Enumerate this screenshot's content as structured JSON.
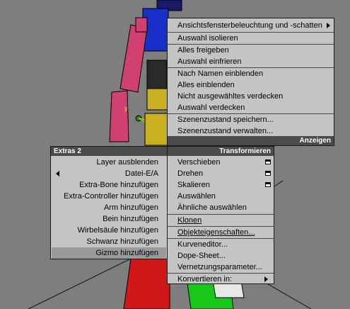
{
  "colors": {
    "viewport_bg": "#7e7e7e",
    "menu_bg": "#c4c4c4",
    "header_bg": "#4b4b4b",
    "highlight": "#9a9a9a"
  },
  "top_menu": {
    "items": [
      "Ansichtsfensterbeleuchtung und -schatten",
      "Auswahl isolieren",
      "Alles freigeben",
      "Auswahl einfrieren",
      "Nach Namen einblenden",
      "Alles einblenden",
      "Nicht ausgewähltes verdecken",
      "Auswahl verdecken",
      "Szenenzustand speichern...",
      "Szenenzustand verwalten..."
    ],
    "footer": "Anzeigen"
  },
  "left_menu": {
    "header": "Extras 2",
    "items": [
      "Layer ausblenden",
      "Datei-E/A",
      "Extra-Bone hinzufügen",
      "Extra-Controller hinzufügen",
      "Arm hinzufügen",
      "Bein hinzufügen",
      "Wirbelsäule hinzufügen",
      "Schwanz hinzufügen",
      "Gizmo hinzufügen"
    ]
  },
  "right_menu": {
    "header": "Transformieren",
    "items": [
      "Verschieben",
      "Drehen",
      "Skalieren",
      "Auswählen",
      "Ähnliche auswählen",
      "Klonen",
      "Objekteigenschaften...",
      "Kurveneditor...",
      "Dope-Sheet...",
      "Vernetzungsparameter...",
      "Konvertieren in:"
    ]
  },
  "viewport": {
    "axis_label": "y"
  }
}
